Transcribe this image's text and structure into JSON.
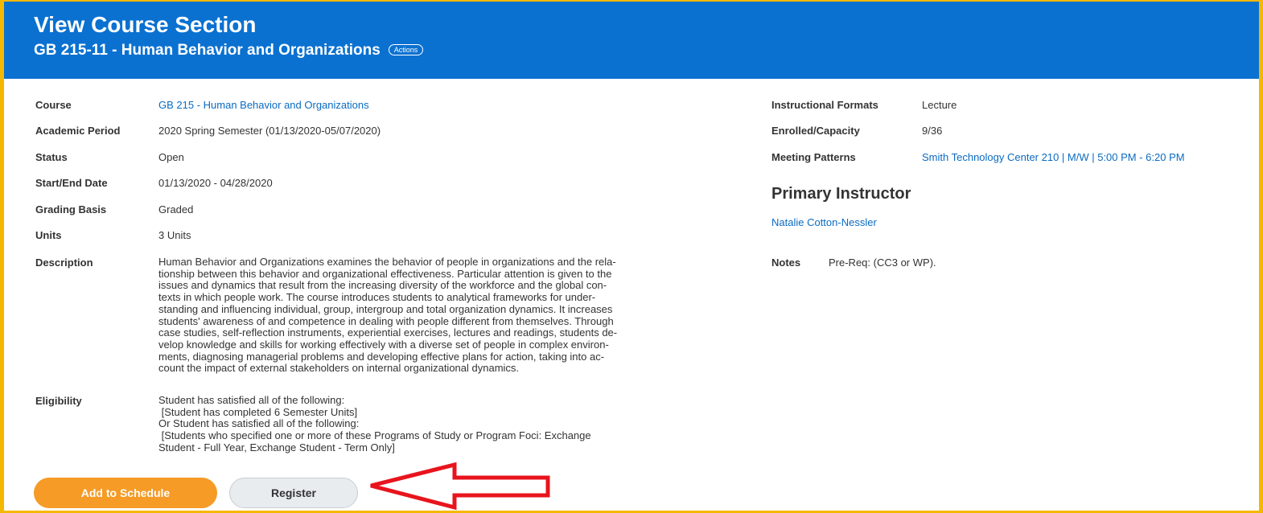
{
  "header": {
    "title": "View Course Section",
    "subtitle": "GB 215-11 - Human Behavior and Organizations",
    "actions_label": "Actions"
  },
  "left_fields": {
    "course": {
      "label": "Course",
      "value": "GB 215 - Human Behavior and Organizations"
    },
    "academic_period": {
      "label": "Academic Period",
      "value": "2020 Spring Semester (01/13/2020-05/07/2020)"
    },
    "status": {
      "label": "Status",
      "value": "Open"
    },
    "start_end_date": {
      "label": "Start/End Date",
      "value": "01/13/2020 - 04/28/2020"
    },
    "grading_basis": {
      "label": "Grading Basis",
      "value": "Graded"
    },
    "units": {
      "label": "Units",
      "value": "3 Units"
    },
    "description": {
      "label": "Description",
      "lines": [
        "Human Behavior and Organizations examines the behavior of people in organizations and the rela-",
        "tionship between this behavior and organizational effectiveness. Particular attention is given to the",
        "issues and dynamics that result from the increasing diversity of the workforce and the global con-",
        "texts in which people work. The course introduces students to analytical frameworks for under-",
        "standing and influencing individual, group, intergroup and total organization dynamics. It increases",
        "students' awareness of and competence in dealing with people different from themselves. Through",
        "case studies, self-reflection instruments, experiential exercises, lectures and readings, students de-",
        "velop knowledge and skills for working effectively with a diverse set of people in complex environ-",
        "ments, diagnosing managerial problems and developing effective plans for action, taking into ac-",
        "count the impact of external stakeholders on internal organizational dynamics."
      ]
    },
    "eligibility": {
      "label": "Eligibility",
      "lines": [
        "Student has satisfied all of the following:",
        " [Student has completed 6 Semester Units]",
        "Or Student has satisfied all of the following:",
        " [Students who specified one or more of these Programs of Study or Program Foci: Exchange",
        "Student - Full Year, Exchange Student - Term Only]"
      ]
    }
  },
  "right_fields": {
    "instructional_formats": {
      "label": "Instructional Formats",
      "value": "Lecture"
    },
    "enrolled_capacity": {
      "label": "Enrolled/Capacity",
      "value": "9/36"
    },
    "meeting_patterns": {
      "label": "Meeting Patterns",
      "value": "Smith Technology Center 210 | M/W | 5:00 PM - 6:20 PM"
    },
    "primary_instructor_heading": "Primary Instructor",
    "instructor_name": "Natalie Cotton-Nessler",
    "notes": {
      "label": "Notes",
      "value": "Pre-Req: (CC3 or WP)."
    }
  },
  "buttons": {
    "add_to_schedule": "Add to Schedule",
    "register": "Register"
  },
  "colors": {
    "header_blue": "#0a71d1",
    "frame_yellow": "#f5b800",
    "primary_orange": "#f59b26",
    "link_blue": "#0a6bc2",
    "annotation_red": "#e8141c"
  },
  "icons": {
    "annotation": "red-arrow-left-icon"
  }
}
